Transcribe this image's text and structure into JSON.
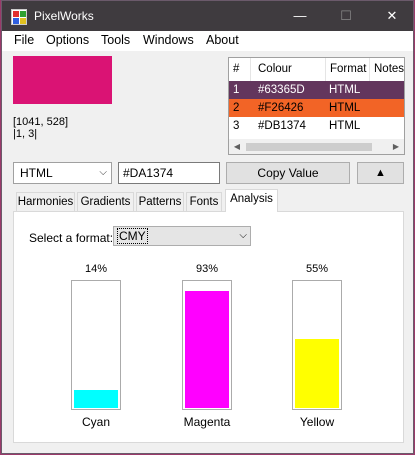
{
  "window": {
    "title": "PixelWorks",
    "minimize_glyph": "—",
    "maximize_glyph": "☐",
    "close_glyph": "✕"
  },
  "menu": [
    "File",
    "Options",
    "Tools",
    "Windows",
    "About"
  ],
  "color_preview": {
    "color": "#DA1374"
  },
  "cursor_position": "[1041, 528]",
  "cursor_cell": "|1, 3|",
  "table": {
    "headers": [
      "#",
      "Colour",
      "Format",
      "Notes"
    ],
    "rows": [
      {
        "num": "1",
        "colour": "#63365D",
        "format": "HTML",
        "bg": "#63365D",
        "fg": "#ffffff"
      },
      {
        "num": "2",
        "colour": "#F26426",
        "format": "HTML",
        "bg": "#F26426",
        "fg": "#000000"
      },
      {
        "num": "3",
        "colour": "#DB1374",
        "format": "HTML",
        "bg": "#ffffff",
        "fg": "#000000"
      }
    ]
  },
  "format_select": {
    "value": "HTML"
  },
  "hex_input": {
    "value": "#DA1374"
  },
  "copy_button": "Copy Value",
  "up_button": "▲",
  "tabs": [
    "Harmonies",
    "Gradients",
    "Patterns",
    "Fonts",
    "Analysis"
  ],
  "active_tab": "Analysis",
  "analysis": {
    "select_label": "Select a format:",
    "select_value": "CMY",
    "bars": [
      {
        "name": "Cyan",
        "percent_label": "14%",
        "value": 0.14,
        "color": "#00FFFF"
      },
      {
        "name": "Magenta",
        "percent_label": "93%",
        "value": 0.93,
        "color": "#FF00FF"
      },
      {
        "name": "Yellow",
        "percent_label": "55%",
        "value": 0.55,
        "color": "#FFFF00"
      }
    ]
  }
}
